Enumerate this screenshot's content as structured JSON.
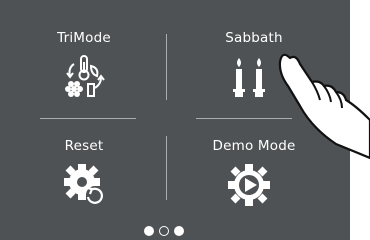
{
  "tiles": {
    "trimode": {
      "label": "TriMode",
      "icon": "trimode-icon"
    },
    "sabbath": {
      "label": "Sabbath",
      "icon": "candles-icon"
    },
    "reset": {
      "label": "Reset",
      "icon": "gear-reset-icon"
    },
    "demo_mode": {
      "label": "Demo Mode",
      "icon": "gear-play-icon"
    }
  },
  "pager": {
    "pages": 3,
    "current_page": 2
  },
  "colors": {
    "panel_background": "#4e5254",
    "foreground": "#ffffff",
    "divider": "#c9cbcc"
  }
}
